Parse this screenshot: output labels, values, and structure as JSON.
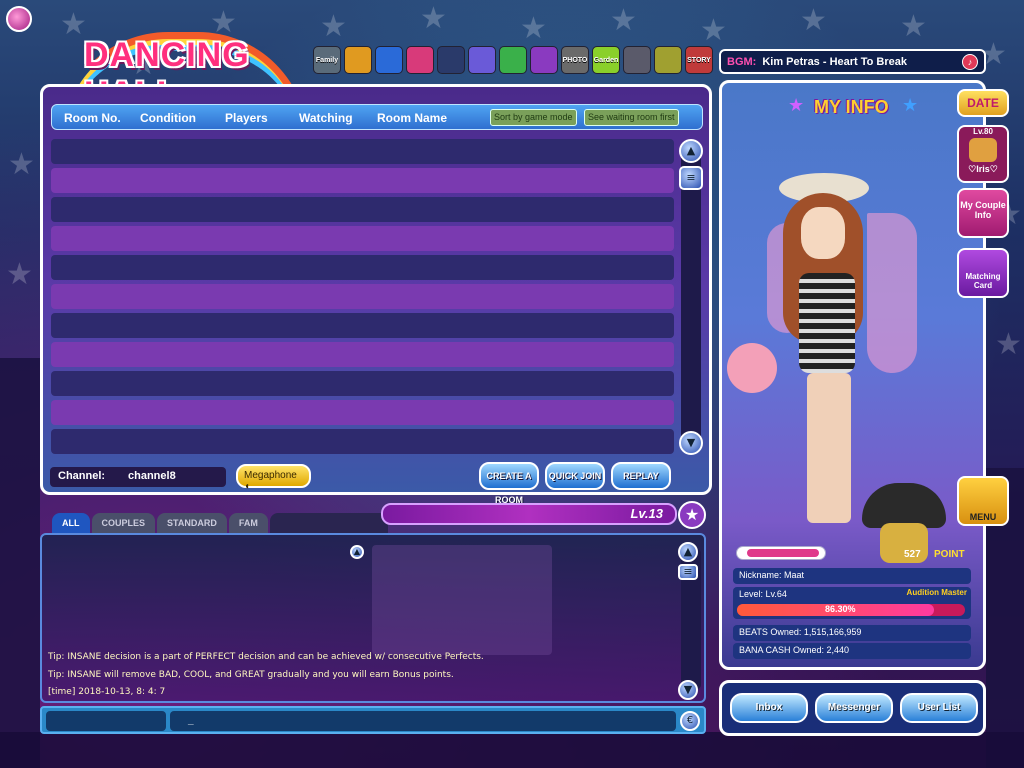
{
  "logo": {
    "text": "DANCING HALL"
  },
  "toolbar": {
    "icons": [
      {
        "name": "family-icon",
        "label": "Family",
        "color": "#5a6b7a"
      },
      {
        "name": "ticket-icon",
        "label": "",
        "color": "#e09a20"
      },
      {
        "name": "gear-flower-icon",
        "label": "",
        "color": "#2a6ad8"
      },
      {
        "name": "gift-icon",
        "label": "",
        "color": "#d83a7a"
      },
      {
        "name": "shadow-icon",
        "label": "",
        "color": "#2a3a6a"
      },
      {
        "name": "group-icon",
        "label": "",
        "color": "#6a5ad8"
      },
      {
        "name": "leaf-icon",
        "label": "",
        "color": "#3ab04a"
      },
      {
        "name": "tv-icon",
        "label": "",
        "color": "#8a3ac0"
      },
      {
        "name": "photo-icon",
        "label": "PHOTO",
        "color": "#6a6a6a"
      },
      {
        "name": "garden-icon",
        "label": "Garden",
        "color": "#8ad02a"
      },
      {
        "name": "shell-icon",
        "label": "",
        "color": "#5a5a6a"
      },
      {
        "name": "book-icon",
        "label": "",
        "color": "#a0a030"
      },
      {
        "name": "story-icon",
        "label": "STORY",
        "color": "#c03a3a"
      }
    ]
  },
  "bgm": {
    "label": "BGM:",
    "track": "Kim Petras - Heart To Break"
  },
  "room_list": {
    "columns": [
      "Room No.",
      "Condition",
      "Players",
      "Watching",
      "Room Name"
    ],
    "sort_mode_label": "Sort by game mode",
    "waiting_first_label": "See waiting room first",
    "channel_label": "Channel:",
    "channel_value": "channel8",
    "megaphone_label": "Megaphone",
    "create_room_label": "CREATE A ROOM",
    "quick_join_label": "QUICK JOIN",
    "replay_label": "REPLAY"
  },
  "chat": {
    "tabs": [
      "ALL",
      "COUPLES",
      "STANDARD",
      "FAM"
    ],
    "level": "Lv.13",
    "lines": [
      "Tip: INSANE decision is a part of PERFECT decision and can be achieved w/ consecutive Perfects.",
      "Tip: INSANE will remove BAD, COOL, and GREAT gradually and you will earn Bonus points.",
      "[time] 2018-10-13,  8: 4: 7"
    ],
    "input_cursor": "_"
  },
  "my_info": {
    "title": "MY INFO",
    "date_label": "DATE",
    "partner_level": "Lv.80",
    "partner_name": "♡Iris♡",
    "couple_info_label": "My Couple Info",
    "matching_card_label": "Matching Card",
    "menu_label": "MENU",
    "points": "527",
    "points_label": "POINT",
    "nickname": "Nickname: Maat",
    "level": "Level: Lv.64",
    "rank_badge": "Audition Master",
    "exp_percent": "86.30%",
    "exp_fraction": 0.863,
    "beats": "BEATS Owned: 1,515,166,959",
    "bana_cash": "BANA CASH Owned: 2,440"
  },
  "bottom_nav": {
    "inbox": "Inbox",
    "messenger": "Messenger",
    "user_list": "User List"
  }
}
